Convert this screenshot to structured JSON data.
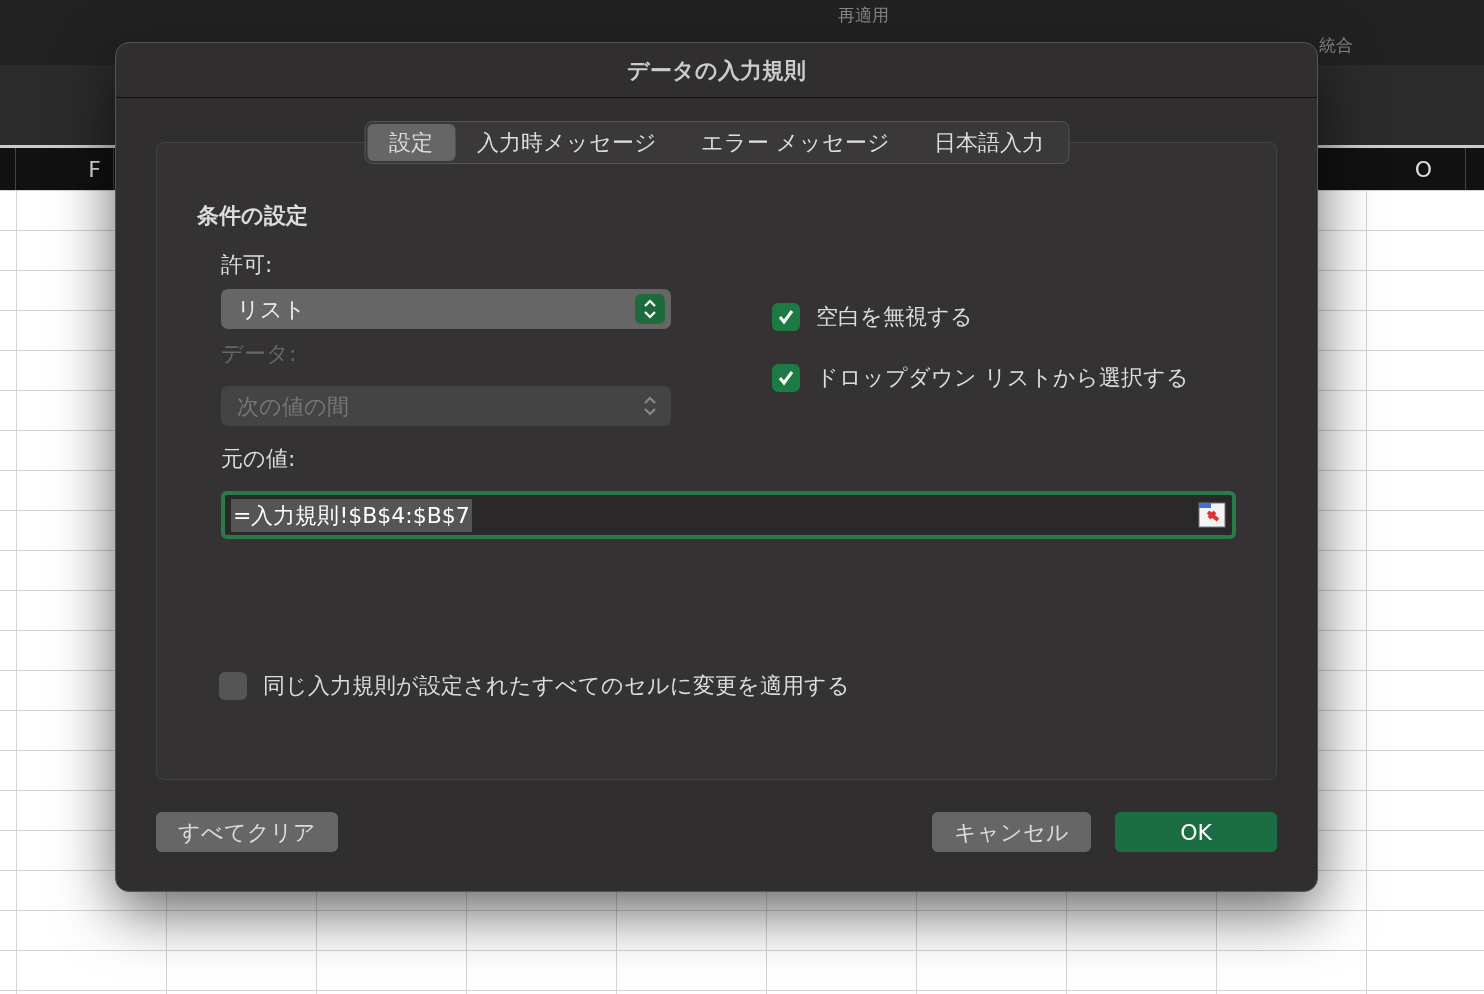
{
  "ribbon": {
    "items": [
      {
        "label": "再適用"
      },
      {
        "label": "統合"
      }
    ]
  },
  "sheet": {
    "column_headers": [
      "F",
      "O"
    ]
  },
  "dialog": {
    "title": "データの入力規則",
    "tabs": [
      {
        "label": "設定",
        "selected": true
      },
      {
        "label": "入力時メッセージ",
        "selected": false
      },
      {
        "label": "エラー メッセージ",
        "selected": false
      },
      {
        "label": "日本語入力",
        "selected": false
      }
    ],
    "section_title": "条件の設定",
    "allow": {
      "label": "許可:",
      "value": "リスト",
      "disabled": false
    },
    "data": {
      "label": "データ:",
      "value": "次の値の間",
      "disabled": true
    },
    "checkboxes": [
      {
        "label": "空白を無視する",
        "checked": true
      },
      {
        "label": "ドロップダウン リストから選択する",
        "checked": true
      }
    ],
    "source": {
      "label": "元の値:",
      "value": "=入力規則!$B$4:$B$7"
    },
    "apply_all": {
      "label": "同じ入力規則が設定されたすべてのセルに変更を適用する",
      "checked": false
    },
    "buttons": [
      {
        "label": "すべてクリア",
        "kind": "secondary"
      },
      {
        "label": "キャンセル",
        "kind": "secondary"
      },
      {
        "label": "OK",
        "kind": "primary"
      }
    ]
  }
}
